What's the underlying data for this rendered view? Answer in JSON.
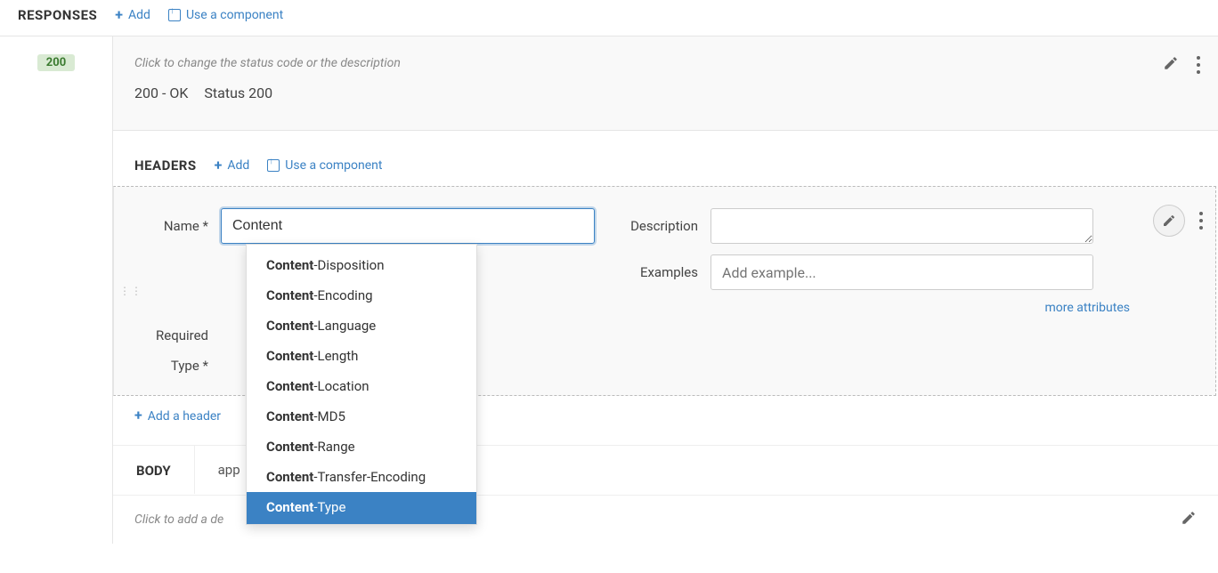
{
  "top": {
    "section_title": "RESPONSES",
    "add_label": "Add",
    "use_component_label": "Use a component"
  },
  "response": {
    "status_badge": "200",
    "hint": "Click to change the status code or the description",
    "status_code_text": "200 - OK",
    "status_desc": "Status 200"
  },
  "headers_section": {
    "title": "HEADERS",
    "add_label": "Add",
    "use_component_label": "Use a component"
  },
  "header_form": {
    "name_label": "Name",
    "name_value": "Content",
    "required_label": "Required",
    "type_label": "Type",
    "description_label": "Description",
    "description_value": "",
    "examples_label": "Examples",
    "examples_placeholder": "Add example...",
    "more_attributes": "more attributes"
  },
  "autocomplete": {
    "items": [
      {
        "match": "Content",
        "rest": "-Disposition"
      },
      {
        "match": "Content",
        "rest": "-Encoding"
      },
      {
        "match": "Content",
        "rest": "-Language"
      },
      {
        "match": "Content",
        "rest": "-Length"
      },
      {
        "match": "Content",
        "rest": "-Location"
      },
      {
        "match": "Content",
        "rest": "-MD5"
      },
      {
        "match": "Content",
        "rest": "-Range"
      },
      {
        "match": "Content",
        "rest": "-Transfer-Encoding"
      },
      {
        "match": "Content",
        "rest": "-Type"
      }
    ],
    "selected_index": 8
  },
  "add_header_label": "Add a header",
  "body": {
    "title": "BODY",
    "type_prefix": "app",
    "desc_hint": "Click to add a de"
  }
}
